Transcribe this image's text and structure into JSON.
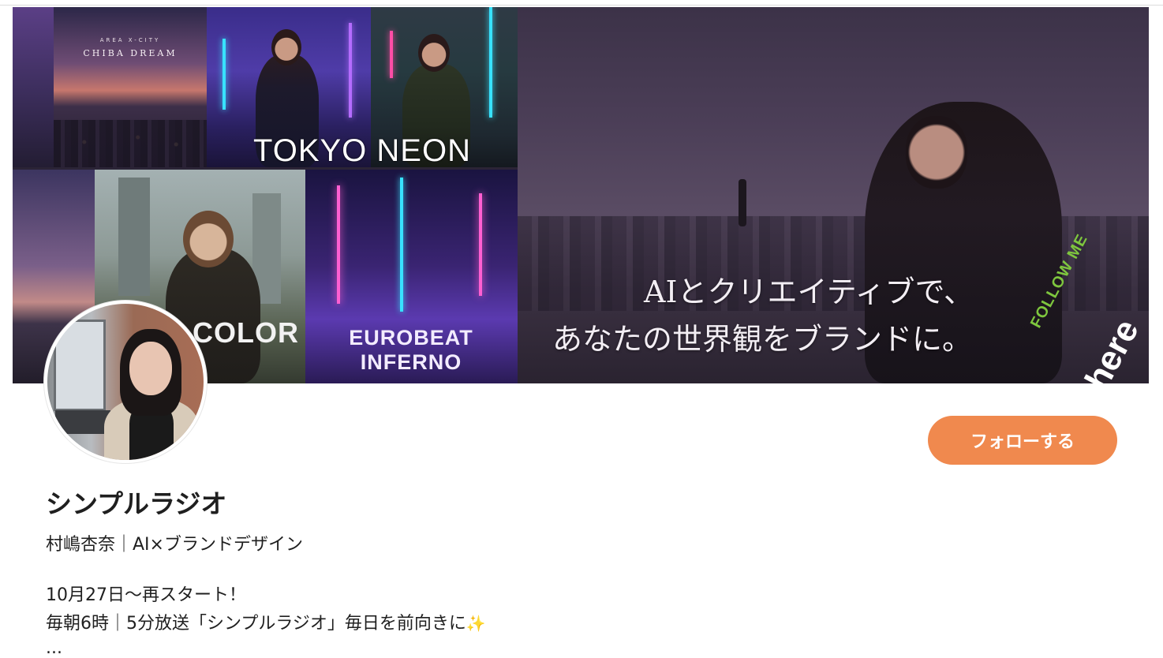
{
  "banner": {
    "chiba_small": "AREA X-CITY",
    "chiba_title": "CHIBA DREAM",
    "tokyo_title": "TOKYO NEON",
    "color_title": "COLOR",
    "euro_title": "EUROBEAT INFERNO",
    "main_line1": "AIとクリエイティブで、",
    "main_line2": "あなたの世界観をブランドに。",
    "follow_me": "FOLLOW ME",
    "here": "here"
  },
  "profile": {
    "follow_label": "フォローする",
    "name": "シンプルラジオ",
    "tagline": "村嶋杏奈｜AI×ブランドデザイン",
    "bio_line1": "10月27日〜再スタート！",
    "bio_line2": "毎朝6時｜5分放送「シンプルラジオ」毎日を前向きに",
    "bio_sparkle": "✨",
    "bio_ellipsis": "..."
  },
  "colors": {
    "accent": "#f0894e",
    "text": "#1f1f1f"
  }
}
